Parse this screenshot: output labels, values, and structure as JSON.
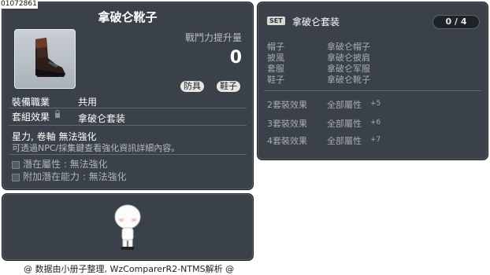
{
  "item": {
    "id_code": "01072861",
    "title": "拿破仑靴子",
    "power_label": "戰鬥力提升量",
    "power_value": "0",
    "tags": [
      "防具",
      "鞋子"
    ],
    "job_label": "裝備職業",
    "job_value": "共用",
    "set_label": "套組效果",
    "set_value": "拿破仑套装",
    "note1": "星力, 卷軸 無法強化",
    "note2": "可透過NPC/採集鍵查看強化資訊詳細內容。",
    "potential": "潛在屬性 : 無法強化",
    "additional_potential": "附加潛在能力 : 無法強化"
  },
  "set_info": {
    "badge": "SET",
    "name": "拿破仑套装",
    "count": "0 / 4",
    "parts": [
      {
        "slot": "帽子",
        "name": "拿破仑帽子"
      },
      {
        "slot": "披風",
        "name": "拿破仑披肩"
      },
      {
        "slot": "套服",
        "name": "拿破仑军服"
      },
      {
        "slot": "鞋子",
        "name": "拿破仑靴子"
      }
    ],
    "effects": [
      {
        "label": "2套裝效果",
        "stat": "全部屬性",
        "value": "+5"
      },
      {
        "label": "3套裝效果",
        "stat": "全部屬性",
        "value": "+6"
      },
      {
        "label": "4套裝效果",
        "stat": "全部屬性",
        "value": "+7"
      }
    ]
  },
  "footer": "@ 数据由小册子整理, WzComparerR2-NTMS解析 @",
  "icons": [
    "boot-icon",
    "lock-icon",
    "bullet-icon",
    "avatar-figure"
  ],
  "colors": {
    "panel_bg": "#3a4148",
    "border": "#1b1f23"
  }
}
